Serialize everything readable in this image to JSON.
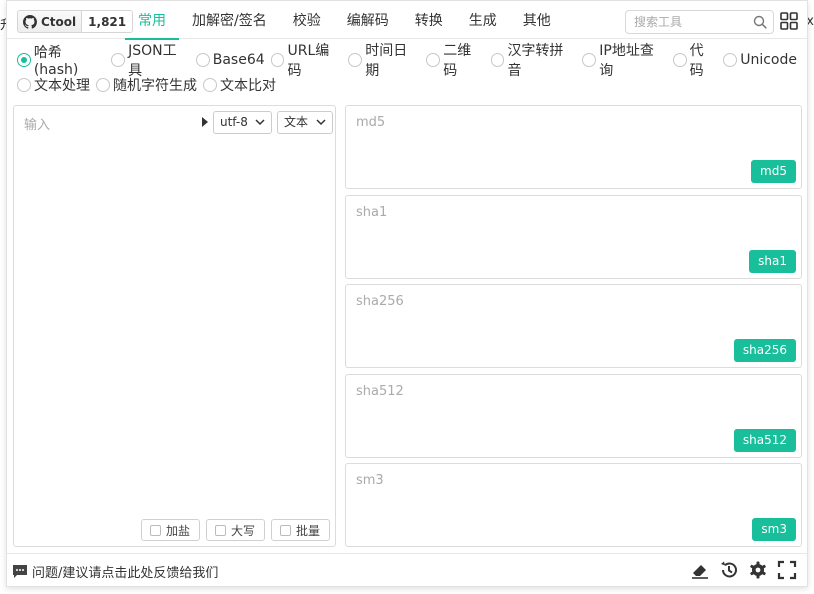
{
  "edge": {
    "left_char": "升",
    "right_char": "x"
  },
  "github": {
    "name": "Ctool",
    "stars": "1,821"
  },
  "tabs": [
    "常用",
    "加解密/签名",
    "校验",
    "编解码",
    "转换",
    "生成",
    "其他"
  ],
  "active_tab": "常用",
  "search": {
    "placeholder": "搜索工具"
  },
  "tools_row1": [
    "哈希(hash)",
    "JSON工具",
    "Base64",
    "URL编码",
    "时间日期",
    "二维码",
    "汉字转拼音",
    "IP地址查询",
    "代码",
    "Unicode"
  ],
  "tools_row2": [
    "文本处理",
    "随机字符生成",
    "文本比对"
  ],
  "selected_tool": "哈希(hash)",
  "input": {
    "placeholder": "输入",
    "encoding": "utf-8",
    "type": "文本"
  },
  "options": [
    "加盐",
    "大写",
    "批量"
  ],
  "hashes": [
    {
      "label": "md5",
      "button": "md5"
    },
    {
      "label": "sha1",
      "button": "sha1"
    },
    {
      "label": "sha256",
      "button": "sha256"
    },
    {
      "label": "sha512",
      "button": "sha512"
    },
    {
      "label": "sm3",
      "button": "sm3"
    }
  ],
  "footer": {
    "feedback": "问题/建议请点击此处反馈给我们"
  },
  "colors": {
    "accent": "#19be9a",
    "border": "#dcdcdc"
  }
}
